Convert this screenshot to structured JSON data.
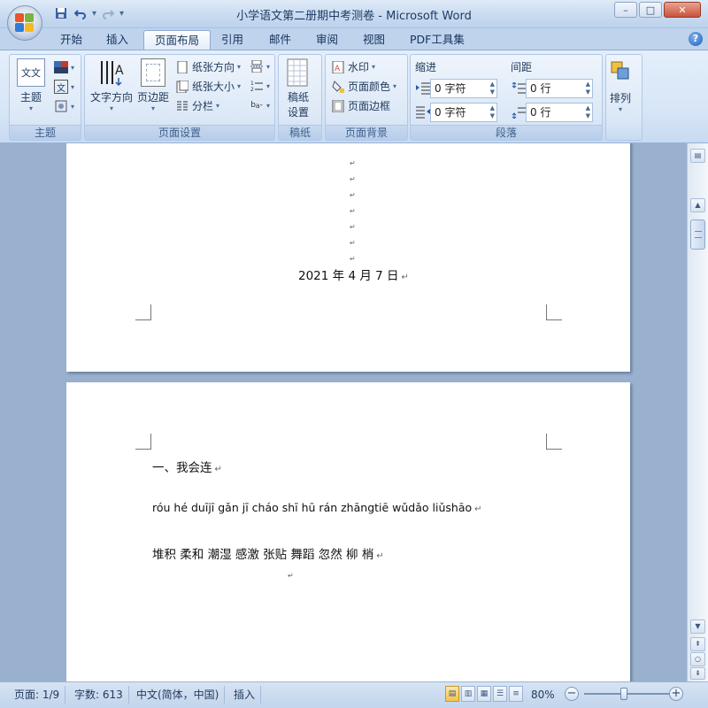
{
  "window": {
    "title": "小学语文第二册期中考测卷 - Microsoft Word",
    "minimize": "–",
    "maximize": "□",
    "close": "✕"
  },
  "qat": {
    "save_icon": "save-icon",
    "undo_icon": "undo-icon",
    "redo_icon": "redo-icon",
    "customize": "▾"
  },
  "tabs": [
    {
      "label": "开始"
    },
    {
      "label": "插入"
    },
    {
      "label": "页面布局",
      "active": true
    },
    {
      "label": "引用"
    },
    {
      "label": "邮件"
    },
    {
      "label": "审阅"
    },
    {
      "label": "视图"
    },
    {
      "label": "PDF工具集"
    }
  ],
  "ribbon": {
    "themes": {
      "label": "主题",
      "button": "主题",
      "icon_text": "文文"
    },
    "page_setup": {
      "label": "页面设置",
      "text_direction": "文字方向",
      "margins": "页边距",
      "orientation": "纸张方向",
      "size": "纸张大小",
      "columns": "分栏"
    },
    "manuscript": {
      "label": "稿纸",
      "button_line1": "稿纸",
      "button_line2": "设置"
    },
    "page_background": {
      "label": "页面背景",
      "watermark": "水印",
      "page_color": "页面颜色",
      "page_borders": "页面边框"
    },
    "paragraph": {
      "label": "段落",
      "indent_label": "缩进",
      "spacing_label": "间距",
      "indent_left": "0 字符",
      "indent_right": "0 字符",
      "spacing_before": "0 行",
      "spacing_after": "0 行"
    },
    "arrange": {
      "label": "排列",
      "button": "排列"
    }
  },
  "document": {
    "page1": {
      "date": "2021 年 4 月 7 日"
    },
    "page2": {
      "heading": "一、我会连",
      "pinyin_line": "róu  hé  duījī  gǎn  jī  cháo  shī  hū  rán  zhāngtiē  wǔdǎo  liǔshāo",
      "words_line": "堆积  柔和  潮湿  感激  张贴  舞蹈  忽然  柳  梢"
    },
    "return_mark": "↵"
  },
  "statusbar": {
    "page": "页面: 1/9",
    "words": "字数: 613",
    "language": "中文(简体，中国)",
    "mode": "插入",
    "zoom": "80%",
    "zoom_level": 0.45
  }
}
